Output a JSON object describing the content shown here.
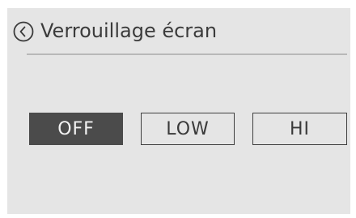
{
  "header": {
    "title": "Verrouillage écran",
    "back_icon": "chevron-left-circle-icon"
  },
  "options": [
    {
      "label": "OFF",
      "selected": true
    },
    {
      "label": "LOW",
      "selected": false
    },
    {
      "label": "HI",
      "selected": false
    }
  ],
  "colors": {
    "background": "#e5e5e5",
    "selected_fill": "#4b4b4b",
    "selected_text": "#f2f2f2",
    "text": "#3a3a3a",
    "divider": "#b8b8b8"
  }
}
